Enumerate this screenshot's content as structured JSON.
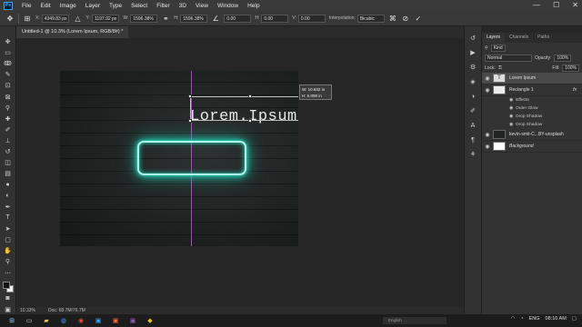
{
  "menubar": {
    "logo": "Ps",
    "items": [
      "File",
      "Edit",
      "Image",
      "Layer",
      "Type",
      "Select",
      "Filter",
      "3D",
      "View",
      "Window",
      "Help"
    ],
    "window_controls": [
      "—",
      "☐",
      "✕"
    ]
  },
  "options_bar": {
    "x_label": "X:",
    "x_value": "4349.83 px",
    "y_label": "Y:",
    "y_value": "1197.92 px",
    "w_label": "W:",
    "w_value": "1596.38%",
    "h_label": "H:",
    "h_value": "1596.38%",
    "angle_value": "0.00",
    "h_skew_label": "H:",
    "h_skew_value": "0.00",
    "v_skew_label": "V:",
    "v_skew_value": "0.00",
    "interpolation_label": "Interpolation:",
    "interpolation_value": "Bicubic"
  },
  "document": {
    "tab_title": "Untitled-1 @ 10.3% (Lorem Ipsum, RGB/8#) *"
  },
  "canvas": {
    "text": "Lorem.Ipsum",
    "tooltip_w": "W: 10.832 in",
    "tooltip_h": "H: 5.099 in",
    "accent_glow": "#27e0c4",
    "guide_color": "#c03bd6"
  },
  "status": {
    "zoom": "10.33%",
    "doc": "Doc: 68.7M/76.7M"
  },
  "layers_panel": {
    "tabs": [
      "Layers",
      "Channels",
      "Paths"
    ],
    "kind_label": "Kind",
    "blend_mode": "Normal",
    "opacity_label": "Opacity:",
    "opacity_value": "100%",
    "lock_label": "Lock:",
    "fill_label": "Fill:",
    "fill_value": "100%",
    "layers": [
      {
        "name": "Lorem Ipsum",
        "thumb": "T",
        "selected": true
      },
      {
        "name": "Rectangle 1",
        "thumb": "",
        "selected": false,
        "fx": "fx"
      },
      {
        "name": "kevin-smit-C...BY-unsplash",
        "thumb": "",
        "selected": false
      },
      {
        "name": "Background",
        "thumb": "",
        "selected": false
      }
    ],
    "effects_label": "Effects",
    "effects": [
      "Outer Glow",
      "Drop Shadow",
      "Drop Shadow"
    ]
  },
  "taskbar": {
    "search_placeholder": "English",
    "language": "ENG",
    "time": "08:16 AM"
  }
}
